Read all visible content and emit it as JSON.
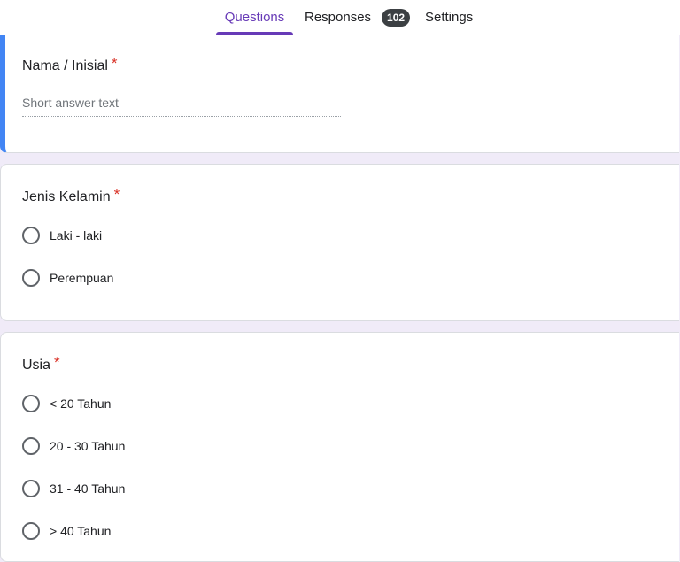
{
  "tabs": {
    "questions": "Questions",
    "responses": "Responses",
    "responses_count": "102",
    "settings": "Settings"
  },
  "questions": [
    {
      "title": "Nama / Inisial",
      "required_mark": "*",
      "placeholder": "Short answer text"
    },
    {
      "title": "Jenis Kelamin",
      "required_mark": "*",
      "options": [
        "Laki - laki",
        "Perempuan"
      ]
    },
    {
      "title": "Usia",
      "required_mark": "*",
      "options": [
        "< 20 Tahun",
        "20 - 30 Tahun",
        "31 - 40 Tahun",
        "> 40 Tahun"
      ]
    }
  ],
  "colors": {
    "accent": "#673ab7",
    "active_card_border": "#4285f4",
    "required": "#d93025",
    "background": "#f0ebf8"
  }
}
